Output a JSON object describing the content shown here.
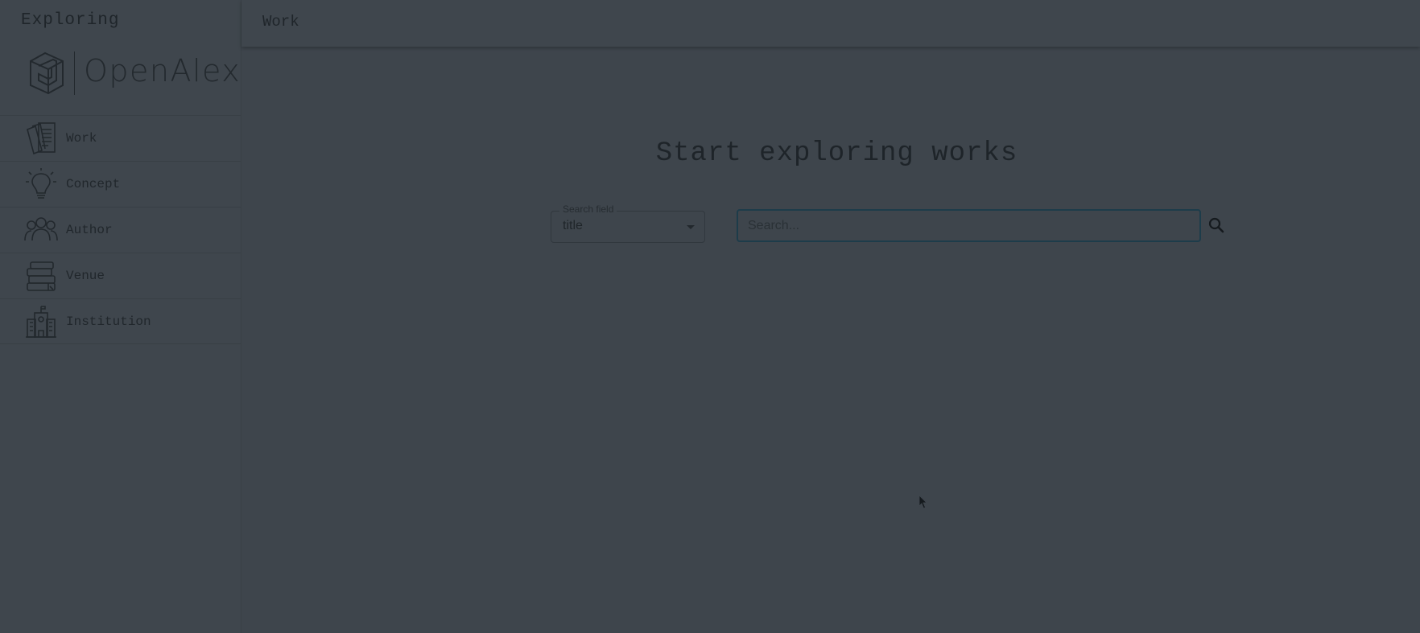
{
  "sidebar": {
    "title": "Exploring",
    "logo_text": "OpenAlex",
    "items": [
      {
        "label": "Work",
        "icon": "papers-icon"
      },
      {
        "label": "Concept",
        "icon": "lightbulb-icon"
      },
      {
        "label": "Author",
        "icon": "people-icon"
      },
      {
        "label": "Venue",
        "icon": "books-icon"
      },
      {
        "label": "Institution",
        "icon": "building-icon"
      }
    ]
  },
  "header": {
    "title": "Work"
  },
  "main": {
    "heading": "Start exploring works",
    "search_field": {
      "label": "Search field",
      "value": "title"
    },
    "search": {
      "placeholder": "Search..."
    }
  },
  "colors": {
    "background": "#3e454c",
    "input_border_focus": "#1d3c4a"
  }
}
